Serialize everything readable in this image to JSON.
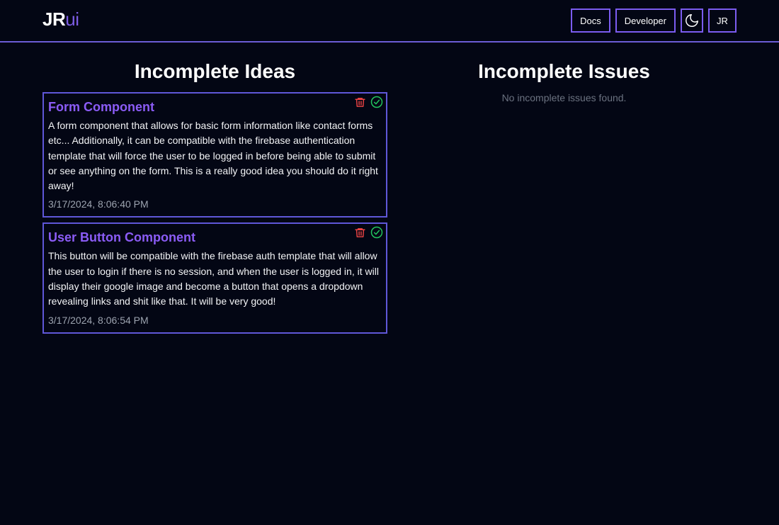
{
  "header": {
    "logo_main": "JR",
    "logo_accent": "ui",
    "docs_label": "Docs",
    "developer_label": "Developer",
    "theme_icon": "moon-icon",
    "avatar_initials": "JR"
  },
  "ideas": {
    "title": "Incomplete Ideas",
    "items": [
      {
        "title": "Form Component",
        "description": "A form component that allows for basic form information like contact forms etc... Additionally, it can be compatible with the firebase authentication template that will force the user to be logged in before being able to submit or see anything on the form. This is a really good idea you should do it right away!",
        "date": "3/17/2024, 8:06:40 PM"
      },
      {
        "title": "User Button Component",
        "description": "This button will be compatible with the firebase auth template that will allow the user to login if there is no session, and when the user is logged in, it will display their google image and become a button that opens a dropdown revealing links and shit like that. It will be very good!",
        "date": "3/17/2024, 8:06:54 PM"
      }
    ]
  },
  "issues": {
    "title": "Incomplete Issues",
    "empty_message": "No incomplete issues found."
  },
  "colors": {
    "background": "#030614",
    "accent": "#7b5cf0",
    "card_title": "#8b5cf6",
    "delete": "#ef4444",
    "complete": "#22c55e"
  }
}
